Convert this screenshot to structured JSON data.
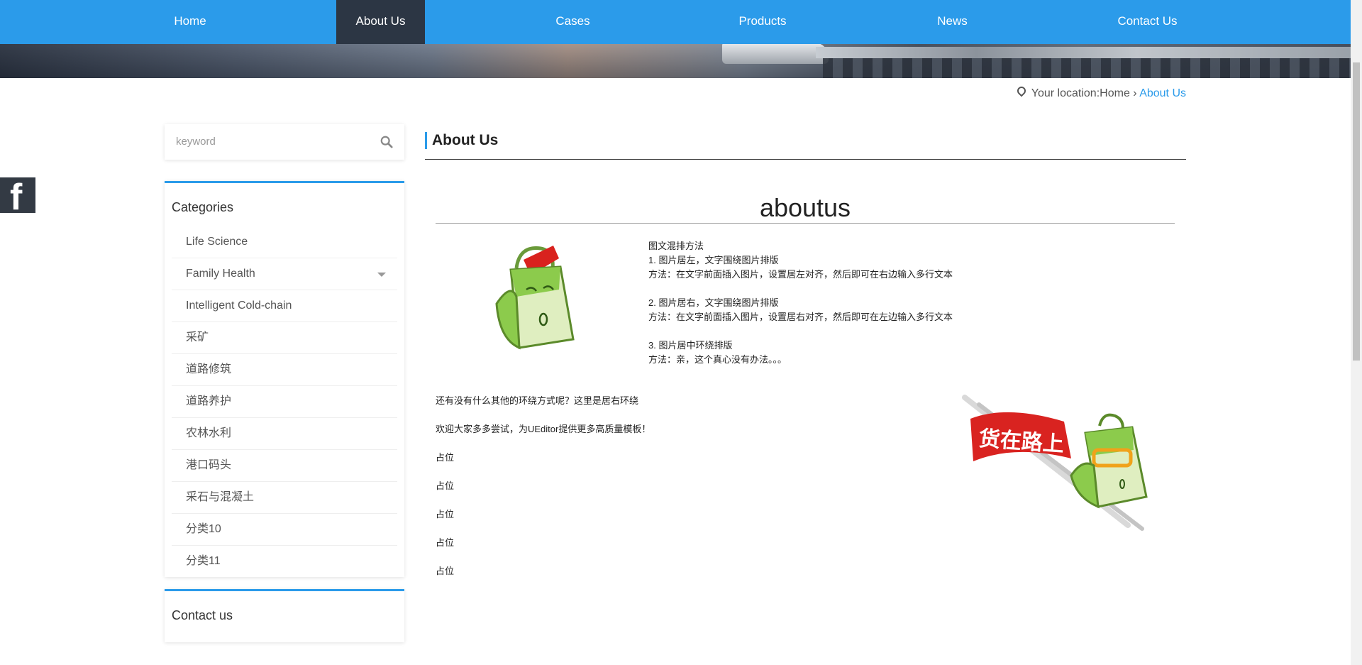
{
  "nav": {
    "items": [
      {
        "label": "Home"
      },
      {
        "label": "About Us"
      },
      {
        "label": "Cases"
      },
      {
        "label": "Products"
      },
      {
        "label": "News"
      },
      {
        "label": "Contact Us"
      }
    ],
    "active_color": "#2c3644",
    "bar_color": "#2b9bea"
  },
  "breadcrumb": {
    "prefix": "Your location:",
    "home": "Home",
    "separator": "›",
    "current": "About Us"
  },
  "social": {
    "icon": "facebook-icon",
    "letter": "f"
  },
  "search": {
    "placeholder": "keyword",
    "icon": "search-icon"
  },
  "categories": {
    "title": "Categories",
    "items": [
      {
        "label": "Life Science"
      },
      {
        "label": "Family Health"
      },
      {
        "label": "Intelligent Cold-chain"
      },
      {
        "label": "采矿"
      },
      {
        "label": "道路修筑"
      },
      {
        "label": "道路养护"
      },
      {
        "label": "农林水利"
      },
      {
        "label": "港口码头"
      },
      {
        "label": "采石与混凝土"
      },
      {
        "label": "分类10"
      },
      {
        "label": "分类11"
      }
    ]
  },
  "contact": {
    "title": "Contact us"
  },
  "main": {
    "header": "About Us",
    "title": "aboutus",
    "float_text": [
      "图文混排方法",
      "1. 图片居左，文字围绕图片排版",
      "方法：在文字前面插入图片，设置居左对齐，然后即可在右边输入多行文本",
      "",
      "2. 图片居右，文字围绕图片排版",
      "方法：在文字前面插入图片，设置居右对齐，然后即可在左边输入多行文本",
      "",
      "3. 图片居中环绕排版",
      "方法：亲，这个真心没有办法。。。"
    ],
    "body": [
      "还有没有什么其他的环绕方式呢？这里是居右环绕",
      "欢迎大家多多尝试，为UEditor提供更多高质量模板！",
      "占位",
      "占位",
      "占位",
      "占位",
      "占位"
    ],
    "image2_text": "货在路上"
  }
}
